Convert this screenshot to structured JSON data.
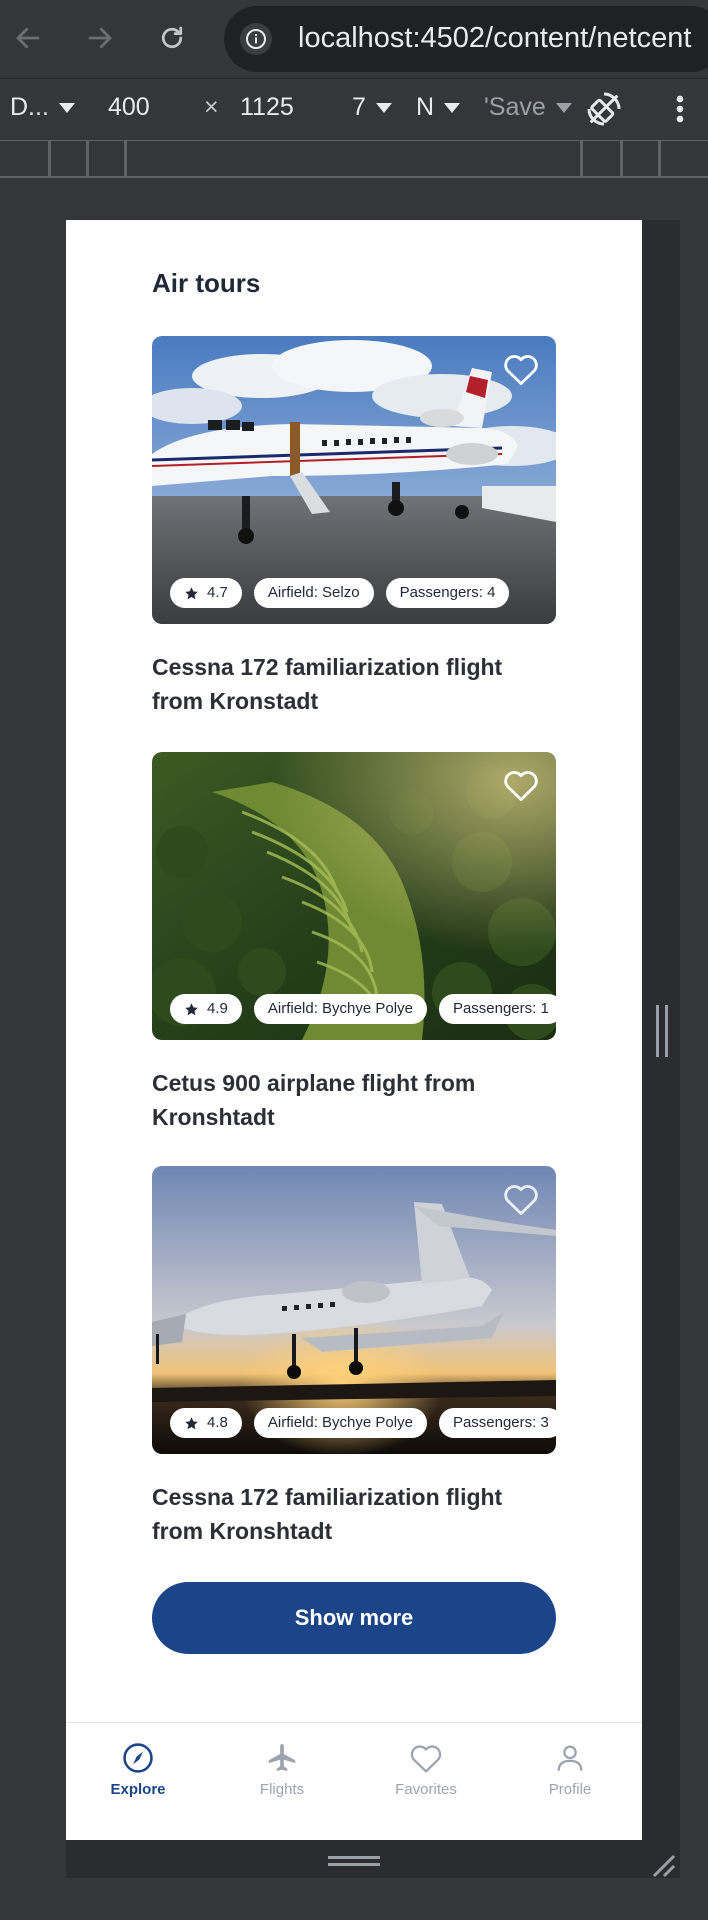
{
  "browser": {
    "url": "localhost:4502/content/netcent",
    "device_label": "D...",
    "width_value": "400",
    "times": "×",
    "height_value": "1125",
    "zoom_label": "7",
    "throttle_label": "N",
    "save_label": "'Save"
  },
  "page": {
    "section_title": "Air tours",
    "cards": [
      {
        "rating": "4.7",
        "airfield": "Airfield: Selzo",
        "passengers": "Passengers: 4",
        "title": "Cessna 172 familiarization flight from Kronstadt"
      },
      {
        "rating": "4.9",
        "airfield": "Airfield: Bychye Polye",
        "passengers": "Passengers: 1",
        "title": "Cetus 900 airplane flight from Kronshtadt"
      },
      {
        "rating": "4.8",
        "airfield": "Airfield: Bychye Polye",
        "passengers": "Passengers: 3",
        "title": "Cessna 172 familiarization flight from Kronshtadt"
      }
    ],
    "show_more_label": "Show more"
  },
  "tabbar": {
    "items": [
      {
        "label": "Explore",
        "icon": "compass-icon"
      },
      {
        "label": "Flights",
        "icon": "plane-icon"
      },
      {
        "label": "Favorites",
        "icon": "heart-icon"
      },
      {
        "label": "Profile",
        "icon": "person-icon"
      }
    ]
  },
  "colors": {
    "accent": "#1c4489",
    "inactive": "#9ca3af"
  }
}
